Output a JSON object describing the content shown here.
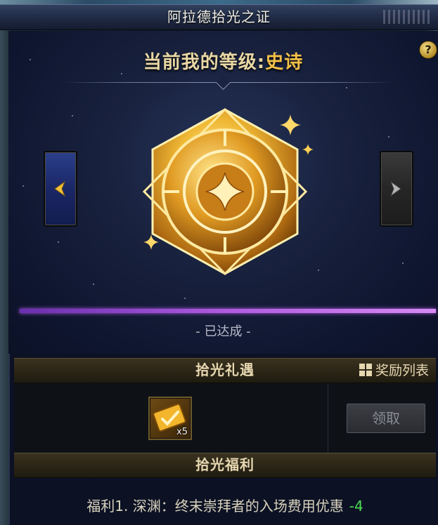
{
  "window": {
    "title": "阿拉德拾光之证"
  },
  "level": {
    "prefix": "当前我的等级:",
    "name": "史诗"
  },
  "help": {
    "label": "?"
  },
  "status": {
    "text": "- 已达成 -"
  },
  "gift_section": {
    "title": "拾光礼遇",
    "reward_list_label": "奖励列表"
  },
  "reward_item": {
    "count": "x5"
  },
  "claim": {
    "label": "领取"
  },
  "benefit_section": {
    "title": "拾光福利"
  },
  "benefit": {
    "text": "福利1. 深渊：终末崇拜者的入场费用优惠",
    "value": "-4"
  },
  "colors": {
    "accent_gold": "#f3c04a",
    "progress": "#b05be0",
    "benefit_value": "#4ddd55"
  },
  "icons": [
    "question-icon",
    "arrow-left-icon",
    "arrow-right-icon",
    "emblem-icon",
    "sparkle-icon",
    "reward-list-icon",
    "ticket-item-icon"
  ]
}
